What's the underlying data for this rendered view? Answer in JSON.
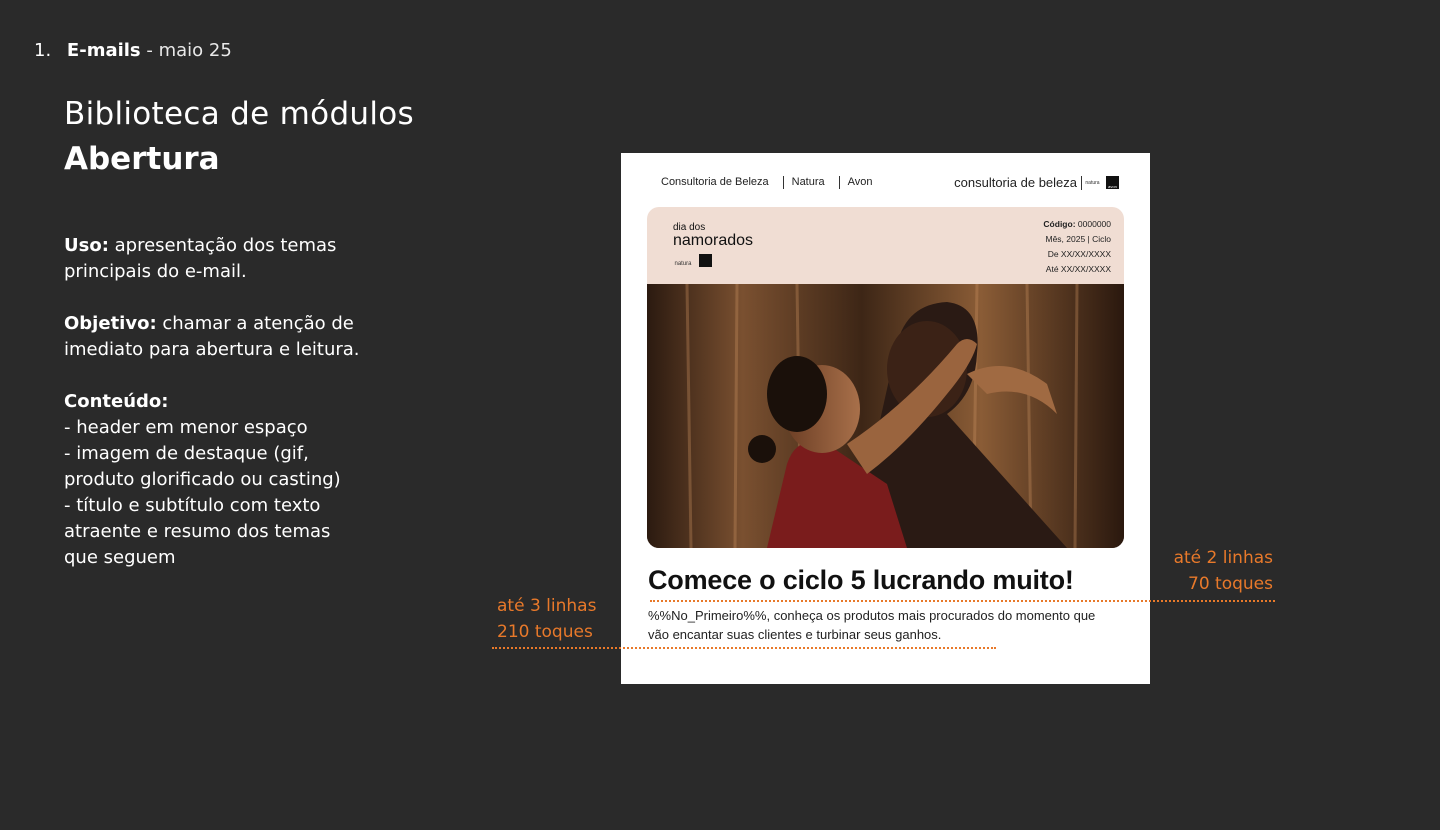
{
  "header": {
    "number": "1.",
    "title": "E-mails",
    "suffix": "- maio 25"
  },
  "library": {
    "title": "Biblioteca de módulos",
    "subtitle": "Abertura"
  },
  "description": {
    "uso_label": "Uso:",
    "uso_text": "apresentação dos temas principais do e-mail.",
    "objetivo_label": "Objetivo:",
    "objetivo_text": "chamar a atenção de imediato para abertura e leitura.",
    "conteudo_label": "Conteúdo:",
    "conteudo_items": [
      "- header em menor espaço",
      "- imagem de destaque (gif, produto glorificado ou casting)",
      "- título e subtítulo  com texto atraente e resumo dos temas que seguem"
    ]
  },
  "email": {
    "nav": [
      "Consultoria de Beleza",
      "Natura",
      "Avon"
    ],
    "brand": "consultoria de beleza",
    "brand_natura": "natura",
    "brand_avon": "avon",
    "banner": {
      "small": "dia dos",
      "big": "namorados",
      "logo_natura": "natura",
      "code_label": "Código:",
      "code_value": "0000000",
      "line2": "Mês, 2025 | Ciclo",
      "line3": "De XX/XX/XXXX",
      "line4": "Até XX/XX/XXXX"
    },
    "headline": "Comece o ciclo 5 lucrando muito!",
    "body": "%%No_Primeiro%%, conheça os produtos mais procurados do momento que vão encantar suas clientes e turbinar seus ganhos."
  },
  "annotations": {
    "right_line1": "até 2 linhas",
    "right_line2": "70 toques",
    "left_line1": "até 3 linhas",
    "left_line2": "210 toques"
  },
  "colors": {
    "background": "#2a2a2a",
    "accent_orange": "#e8792a",
    "banner_pink": "#f0ddd3"
  }
}
